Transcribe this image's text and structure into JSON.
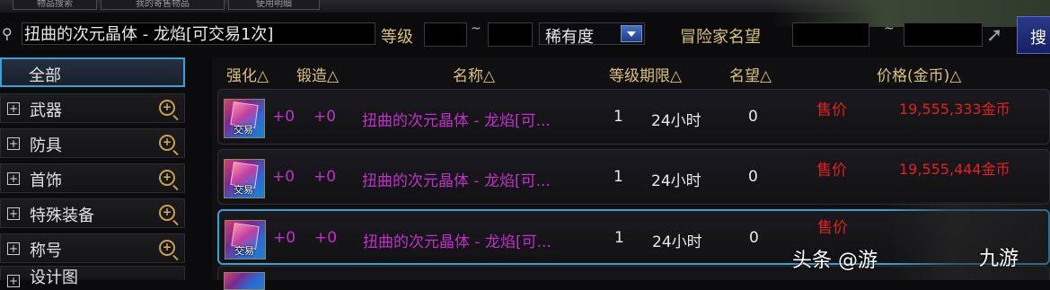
{
  "top_tabs": [
    "物品搜索",
    "我的寄售物品",
    "使用明细"
  ],
  "search": {
    "query": "扭曲的次元晶体 - 龙焰[可交易1次]",
    "level_label": "等级",
    "level_min": "",
    "level_sep": "~",
    "level_max": "",
    "rarity_label": "稀有度",
    "adventurer_label": "冒险家名望",
    "adventurer_min": "",
    "adventurer_sep": "~",
    "adventurer_max": "",
    "search_button": "搜"
  },
  "sidebar": {
    "items": [
      {
        "label": "全部",
        "active": true
      },
      {
        "label": "武器"
      },
      {
        "label": "防具"
      },
      {
        "label": "首饰"
      },
      {
        "label": "特殊装备"
      },
      {
        "label": "称号"
      },
      {
        "label": "设计图"
      }
    ]
  },
  "columns": [
    "强化△",
    "锻造△",
    "名称△",
    "等级期限△",
    "名望△",
    "价格(金币)△"
  ],
  "rows": [
    {
      "icon_tag": "交易",
      "reinforce": "+0",
      "forge": "+0",
      "name": "扭曲的次元晶体 - 龙焰[可...",
      "level": "1",
      "term": "24小时",
      "fame": "0",
      "sale": "售价",
      "price": "19,555,333金币"
    },
    {
      "icon_tag": "交易",
      "reinforce": "+0",
      "forge": "+0",
      "name": "扭曲的次元晶体 - 龙焰[可...",
      "level": "1",
      "term": "24小时",
      "fame": "0",
      "sale": "售价",
      "price": "19,555,444金币"
    },
    {
      "icon_tag": "交易",
      "reinforce": "+0",
      "forge": "+0",
      "name": "扭曲的次元晶体 - 龙焰[可...",
      "level": "1",
      "term": "24小时",
      "fame": "0",
      "sale": "售价",
      "price": ""
    }
  ],
  "watermark": {
    "text": "头条 @游",
    "logo": "九游"
  },
  "colors": {
    "accent_blue": "#3aa0d8",
    "item_name": "#c030c8",
    "price_red": "#e02020",
    "header_gold": "#d8c27a"
  }
}
